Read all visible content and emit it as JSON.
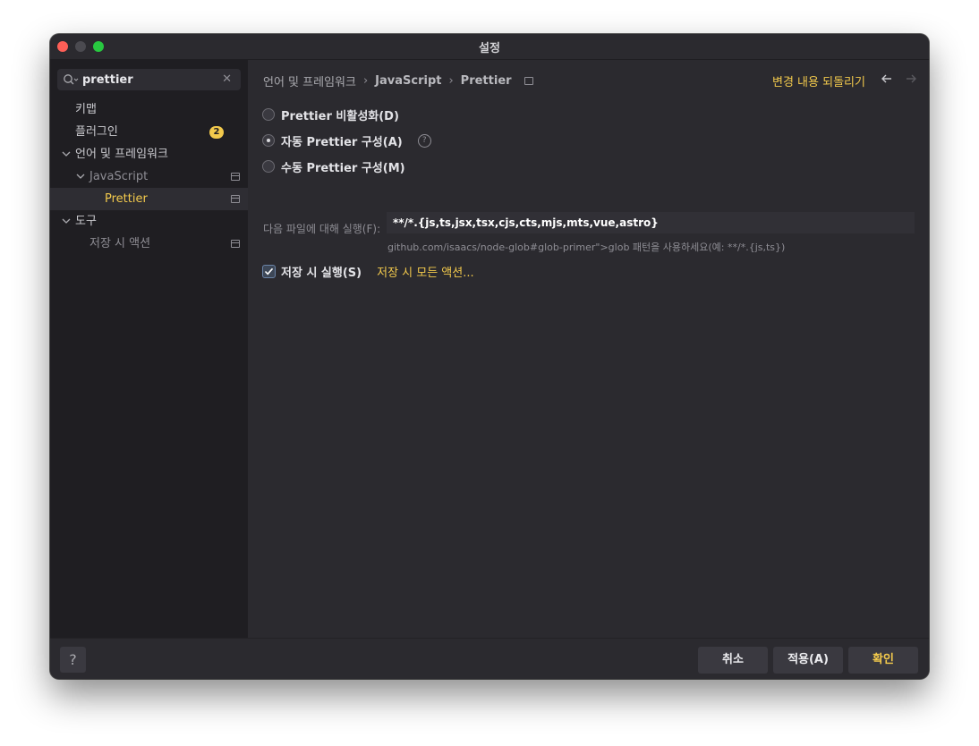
{
  "window": {
    "title": "설정"
  },
  "search": {
    "value": "prettier",
    "clear_glyph": "✕"
  },
  "sidebar": {
    "keymap": "키맵",
    "plugins": "플러그인",
    "plugins_badge": "2",
    "lang": "언어 및 프레임워크",
    "javascript": "JavaScript",
    "prettier": "Prettier",
    "tools": "도구",
    "save_actions": "저장 시 액션"
  },
  "breadcrumb": {
    "part1": "언어 및 프레임워크",
    "part2": "JavaScript",
    "part3": "Prettier",
    "sep": "›"
  },
  "header": {
    "revert": "변경 내용 되돌리기"
  },
  "options": {
    "disable": "Prettier 비활성화(D)",
    "auto": "자동 Prettier 구성(A)",
    "manual": "수동 Prettier 구성(M)",
    "selected": "auto",
    "help_glyph": "?"
  },
  "run_for": {
    "label": "다음 파일에 대해 실행(F):",
    "value": "**/*.{js,ts,jsx,tsx,cjs,cts,mjs,mts,vue,astro}",
    "hint": "github.com/isaacs/node-glob#glob-primer\">glob 패턴을 사용하세요(예: **/*.{js,ts})"
  },
  "on_save": {
    "label": "저장 시 실행(S)",
    "checked": true,
    "link": "저장 시 모든 액션..."
  },
  "footer": {
    "help": "?",
    "cancel": "취소",
    "apply": "적용(A)",
    "ok": "확인"
  },
  "colors": {
    "accent": "#f2c94c",
    "background": "#2b2a2f",
    "sidebar": "#1f1e22"
  }
}
